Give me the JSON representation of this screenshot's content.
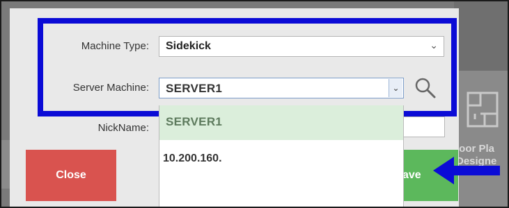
{
  "background": {
    "tile_label": "loor Pla\nDesigne"
  },
  "dialog": {
    "machine_type": {
      "label": "Machine Type:",
      "value": "Sidekick"
    },
    "server_machine": {
      "label": "Server Machine:",
      "value": "SERVER1"
    },
    "nickname": {
      "label": "NickName:"
    },
    "buttons": {
      "close": "Close",
      "save": "ave"
    }
  },
  "dropdown": {
    "options": [
      "SERVER1",
      "10.200.160."
    ]
  },
  "colors": {
    "highlight_border": "#0b0bd6",
    "close_button": "#d9534f",
    "save_button": "#5cb85c",
    "selected_option": "#dbeedb",
    "arrow": "#0b0bd6"
  },
  "icons": {
    "search": "search-icon",
    "dropdown": "chevron-down-icon",
    "floor_plan": "floor-plan-icon",
    "annotation": "arrow-left-icon"
  }
}
